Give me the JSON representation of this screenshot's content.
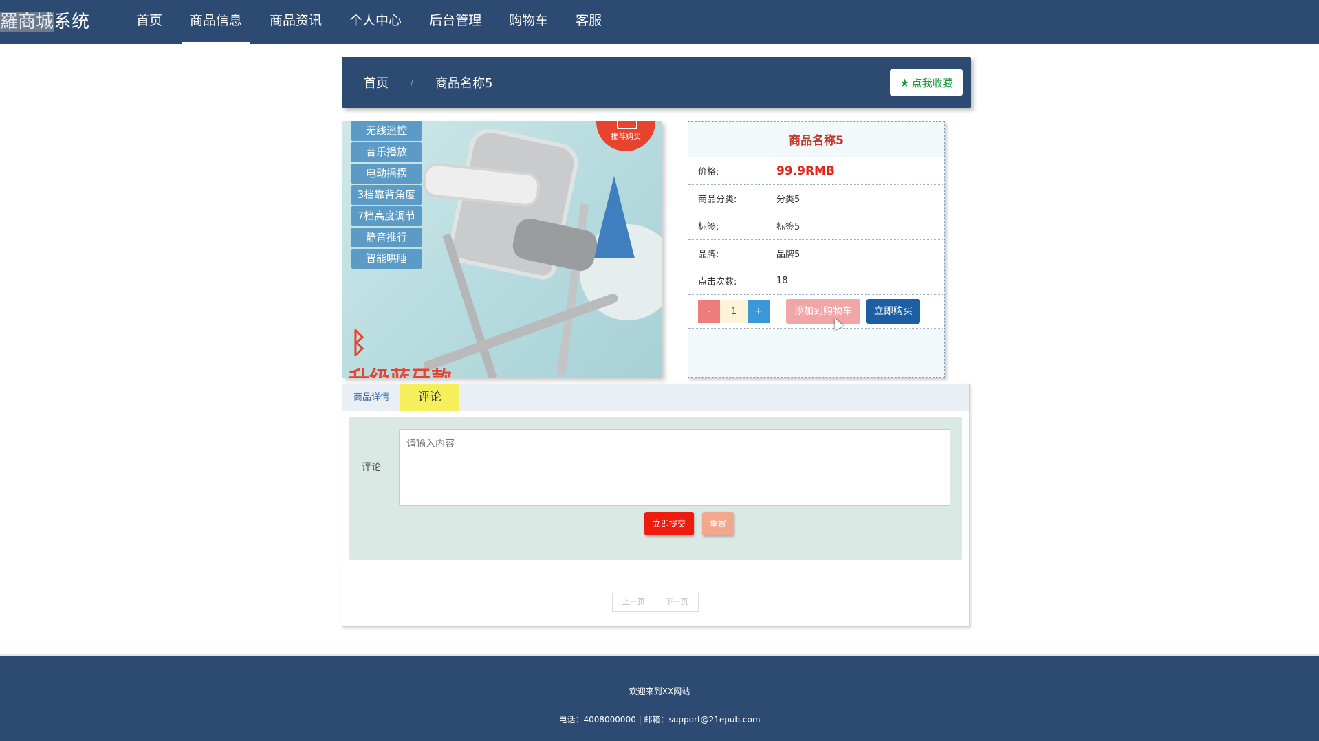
{
  "header": {
    "brand_highlight": "羅商城",
    "brand_rest": "系统",
    "nav": [
      {
        "label": "首页",
        "active": false
      },
      {
        "label": "商品信息",
        "active": true
      },
      {
        "label": "商品资讯",
        "active": false
      },
      {
        "label": "个人中心",
        "active": false
      },
      {
        "label": "后台管理",
        "active": false
      },
      {
        "label": "购物车",
        "active": false
      },
      {
        "label": "客服",
        "active": false
      }
    ]
  },
  "breadcrumb": {
    "home": "首页",
    "separator": "/",
    "current": "商品名称5",
    "favorite_label": "点我收藏",
    "favorite_icon": "star-icon"
  },
  "product_image": {
    "features": [
      "无线遥控",
      "音乐播放",
      "电动摇摆",
      "3档靠背角度",
      "7档高度调节",
      "静音推行",
      "智能哄睡"
    ],
    "badge": "推荐购买",
    "promo": "升级蓝牙款"
  },
  "product": {
    "name": "商品名称5",
    "rows": [
      {
        "key": "价格:",
        "value": "99.9RMB",
        "is_price": true
      },
      {
        "key": "商品分类:",
        "value": "分类5"
      },
      {
        "key": "标签:",
        "value": "标签5"
      },
      {
        "key": "品牌:",
        "value": "品牌5"
      },
      {
        "key": "点击次数:",
        "value": "18"
      }
    ],
    "qty_minus": "-",
    "qty_value": "1",
    "qty_plus": "+",
    "add_to_cart": "添加到购物车",
    "buy_now": "立即购买"
  },
  "tabs": {
    "items": [
      {
        "label": "商品详情",
        "active": false
      },
      {
        "label": "评论",
        "active": true
      }
    ],
    "comment_label": "评论",
    "comment_placeholder": "请输入内容",
    "submit": "立即提交",
    "reset": "重置",
    "prev": "上一页",
    "next": "下一页"
  },
  "footer": {
    "welcome": "欢迎来到XX网站",
    "contact": "电话：4008000000 | 邮箱：support@21epub.com"
  },
  "colors": {
    "primary": "#2c4a72",
    "price": "#e62117",
    "favorite": "#1a9a3a",
    "submit": "#ee1b0f"
  }
}
